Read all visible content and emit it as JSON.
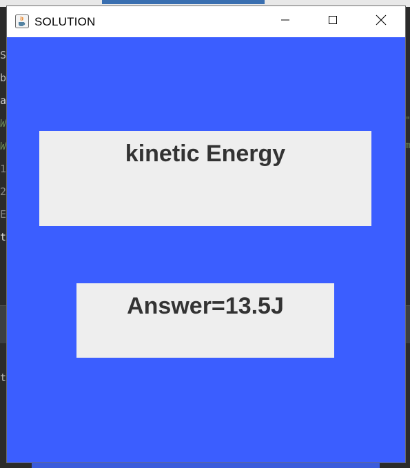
{
  "window": {
    "title": "SOLUTION",
    "icon": "java-cup-icon",
    "controls": {
      "minimize": "minimize-icon",
      "maximize": "maximize-icon",
      "close": "close-icon"
    }
  },
  "content": {
    "background_color": "#3b5eff",
    "heading": "kinetic Energy",
    "answer": "Answer=13.5J"
  },
  "background_editor": {
    "left_chars": [
      "S",
      "b",
      "a",
      "W",
      "W",
      "1",
      "2",
      "E",
      "t",
      "t"
    ],
    "right_chars": [
      "\"",
      "m"
    ]
  }
}
